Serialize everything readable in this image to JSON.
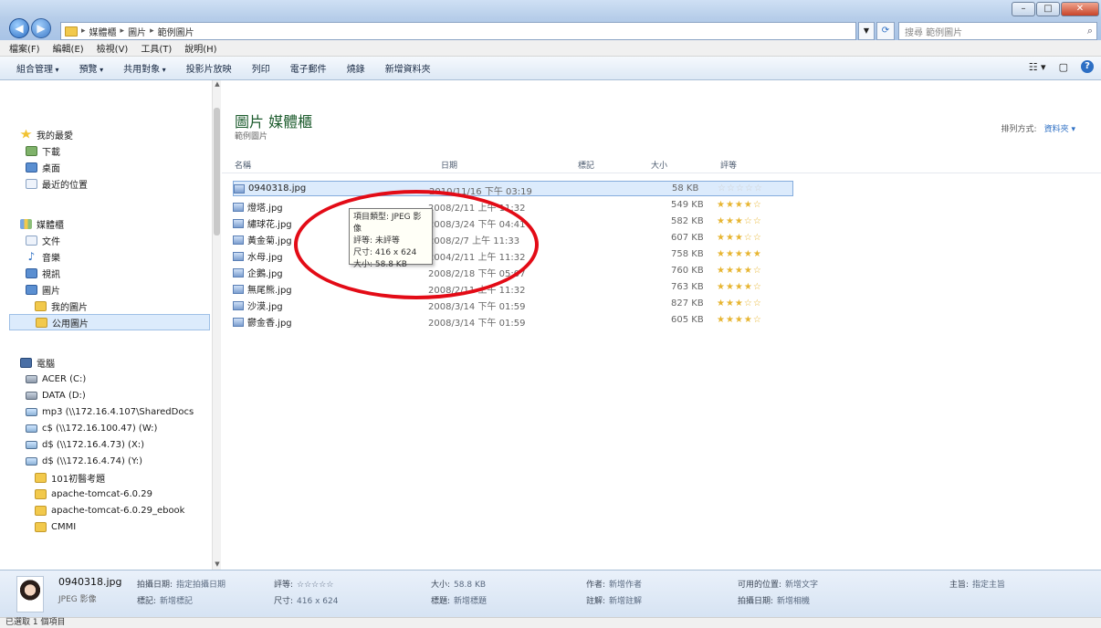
{
  "window": {
    "controls": [
      "–",
      "□",
      "✕"
    ]
  },
  "address": {
    "crumbs": [
      "媒體櫃",
      "圖片",
      "範例圖片"
    ],
    "search_placeholder": "搜尋 範例圖片"
  },
  "menu": [
    "檔案(F)",
    "編輯(E)",
    "檢視(V)",
    "工具(T)",
    "說明(H)"
  ],
  "commands": [
    "組合管理",
    "預覽",
    "共用對象",
    "投影片放映",
    "列印",
    "電子郵件",
    "燒錄",
    "新增資料夾"
  ],
  "nav": {
    "favorites": [
      "我的最愛",
      "下載",
      "桌面",
      "最近的位置"
    ],
    "libraries": [
      "媒體櫃",
      "文件",
      "音樂",
      "視訊",
      "圖片",
      "我的圖片",
      "公用圖片"
    ],
    "computer": [
      "電腦",
      "ACER (C:)",
      "DATA (D:)",
      "mp3 (\\\\172.16.4.107\\SharedDocs",
      "c$ (\\\\172.16.100.47) (W:)",
      "d$ (\\\\172.16.4.73) (X:)",
      "d$ (\\\\172.16.4.74) (Y:)",
      "101初醫考題",
      "apache-tomcat-6.0.29",
      "apache-tomcat-6.0.29_ebook",
      "CMMI"
    ]
  },
  "library": {
    "title": "圖片 媒體櫃",
    "subtitle": "範例圖片",
    "arrange_label": "排列方式:",
    "arrange_value": "資料夾"
  },
  "columns": [
    "名稱",
    "日期",
    "標記",
    "大小",
    "評等"
  ],
  "files": [
    {
      "name": "0940318.jpg",
      "date": "2010/11/16 下午 03:19",
      "size": "58 KB",
      "rating": 0
    },
    {
      "name": "燈塔.jpg",
      "date": "2008/2/11 上午 11:32",
      "size": "549 KB",
      "rating": 4
    },
    {
      "name": "繡球花.jpg",
      "date": "2008/3/24 下午 04:41",
      "size": "582 KB",
      "rating": 3
    },
    {
      "name": "黃金菊.jpg",
      "date": "2008/2/7 上午 11:33",
      "size": "607 KB",
      "rating": 3
    },
    {
      "name": "水母.jpg",
      "date": "2004/2/11 上午 11:32",
      "size": "758 KB",
      "rating": 5
    },
    {
      "name": "企鵝.jpg",
      "date": "2008/2/18 下午 05:07",
      "size": "760 KB",
      "rating": 4
    },
    {
      "name": "無尾熊.jpg",
      "date": "2008/2/11 上午 11:32",
      "size": "763 KB",
      "rating": 4
    },
    {
      "name": "沙漠.jpg",
      "date": "2008/3/14 下午 01:59",
      "size": "827 KB",
      "rating": 3
    },
    {
      "name": "鬱金香.jpg",
      "date": "2008/3/14 下午 01:59",
      "size": "605 KB",
      "rating": 4
    }
  ],
  "tooltip": [
    "項目類型: JPEG 影像",
    "評等: 未評等",
    "尺寸: 416 x 624",
    "大小: 58.8 KB"
  ],
  "details": {
    "name": "0940318.jpg",
    "type": "JPEG 影像",
    "fields": [
      {
        "label": "拍攝日期:",
        "value": "指定拍攝日期"
      },
      {
        "label": "標記:",
        "value": "新增標記"
      },
      {
        "label": "評等:",
        "value": "☆☆☆☆☆"
      },
      {
        "label": "尺寸:",
        "value": "416 x 624"
      },
      {
        "label": "大小:",
        "value": "58.8 KB"
      },
      {
        "label": "標題:",
        "value": "新增標題"
      },
      {
        "label": "作者:",
        "value": "新增作者"
      },
      {
        "label": "註解:",
        "value": "新增註解"
      },
      {
        "label": "可用的位置:",
        "value": "新增文字"
      },
      {
        "label": "拍攝日期:",
        "value": "新增相機"
      },
      {
        "label": "主旨:",
        "value": "指定主旨"
      }
    ]
  },
  "status": "已選取 1 個項目",
  "colors": {
    "annotation": "#e30b16",
    "selected_row": "#dcebfc",
    "rating_star": "#e7b531"
  }
}
